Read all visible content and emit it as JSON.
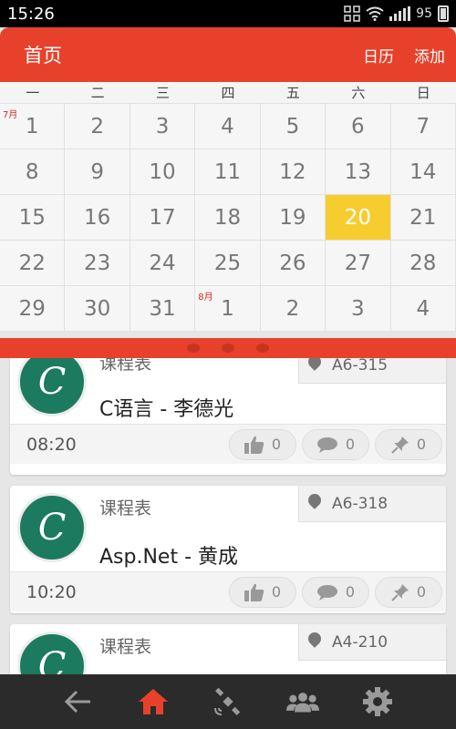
{
  "status_bar": {
    "time": "15:26",
    "battery": "95"
  },
  "header": {
    "title": "首页",
    "actions": [
      "日历",
      "添加"
    ]
  },
  "calendar": {
    "weekdays": [
      "一",
      "二",
      "三",
      "四",
      "五",
      "六",
      "日"
    ],
    "days": [
      {
        "day": "1",
        "month": "7月"
      },
      {
        "day": "2"
      },
      {
        "day": "3"
      },
      {
        "day": "4"
      },
      {
        "day": "5"
      },
      {
        "day": "6"
      },
      {
        "day": "7"
      },
      {
        "day": "8"
      },
      {
        "day": "9"
      },
      {
        "day": "10"
      },
      {
        "day": "11"
      },
      {
        "day": "12"
      },
      {
        "day": "13"
      },
      {
        "day": "14"
      },
      {
        "day": "15"
      },
      {
        "day": "16"
      },
      {
        "day": "17"
      },
      {
        "day": "18"
      },
      {
        "day": "19"
      },
      {
        "day": "20",
        "selected": true
      },
      {
        "day": "21"
      },
      {
        "day": "22"
      },
      {
        "day": "23"
      },
      {
        "day": "24"
      },
      {
        "day": "25"
      },
      {
        "day": "26"
      },
      {
        "day": "27"
      },
      {
        "day": "28"
      },
      {
        "day": "29"
      },
      {
        "day": "30"
      },
      {
        "day": "31"
      },
      {
        "day": "1",
        "month": "8月"
      },
      {
        "day": "2"
      },
      {
        "day": "3"
      },
      {
        "day": "4"
      }
    ]
  },
  "schedule": [
    {
      "type": "课程表",
      "location": "A6-315",
      "name": "C语言 - 李德光",
      "time": "08:20",
      "likes": "0",
      "comments": "0",
      "pins": "0"
    },
    {
      "type": "课程表",
      "location": "A6-318",
      "name": "Asp.Net - 黄成",
      "time": "10:20",
      "likes": "0",
      "comments": "0",
      "pins": "0"
    },
    {
      "type": "课程表",
      "location": "A4-210",
      "name": "",
      "time": "",
      "likes": "",
      "comments": "",
      "pins": ""
    }
  ],
  "avatar_letter": "C",
  "nav": {
    "icons": [
      "back-icon",
      "home-icon",
      "satellite-icon",
      "group-icon",
      "settings-icon"
    ],
    "active": "home-icon"
  },
  "colors": {
    "primary": "#e8412b",
    "selected_day": "#f7cc2e",
    "nav_bg": "#2b2b2b",
    "avatar": "#1c7a5e"
  }
}
